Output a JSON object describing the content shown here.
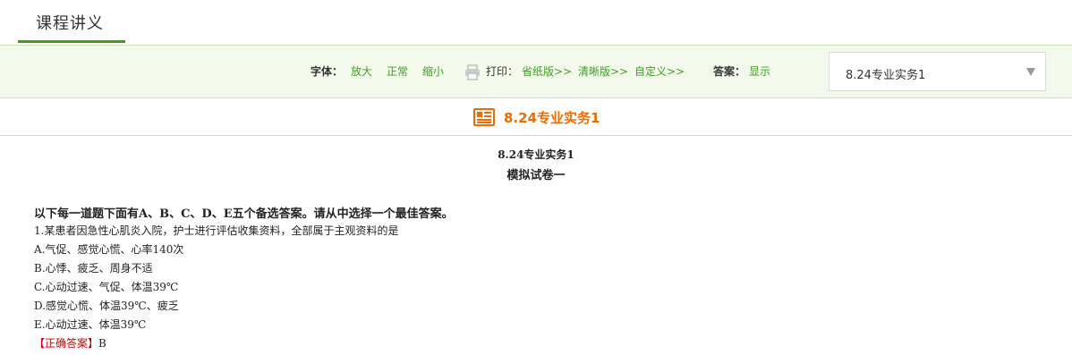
{
  "header": {
    "title": "课程讲义"
  },
  "toolbar": {
    "font_label": "字体：",
    "font_large": "放大",
    "font_normal": "正常",
    "font_small": "缩小",
    "print_label": "打印：",
    "print_save": "省纸版>>",
    "print_clear": "清晰版>>",
    "print_custom": "自定义>>",
    "answer_label": "答案：",
    "answer_show": "显示",
    "select_value": "8.24专业实务1"
  },
  "banner": {
    "title": "8.24专业实务1"
  },
  "document": {
    "heading": "8.24专业实务1",
    "subheading": "模拟试卷一",
    "instruction": "以下每一道题下面有A、B、C、D、E五个备选答案。请从中选择一个最佳答案。",
    "question": "1.某患者因急性心肌炎入院，护士进行评估收集资料，全部属于主观资料的是",
    "options": [
      "A.气促、感觉心慌、心率140次",
      "B.心悸、疲乏、周身不适",
      "C.心动过速、气促、体温39℃",
      "D.感觉心慌、体温39℃、疲乏",
      "E.心动过速、体温39℃"
    ],
    "answer_tag": "【正确答案】",
    "answer_value": "B"
  },
  "colors": {
    "accent_green": "#37a21c",
    "link_green": "#3f9e23",
    "banner_orange": "#ef6c00",
    "answer_red": "#cc0000"
  }
}
